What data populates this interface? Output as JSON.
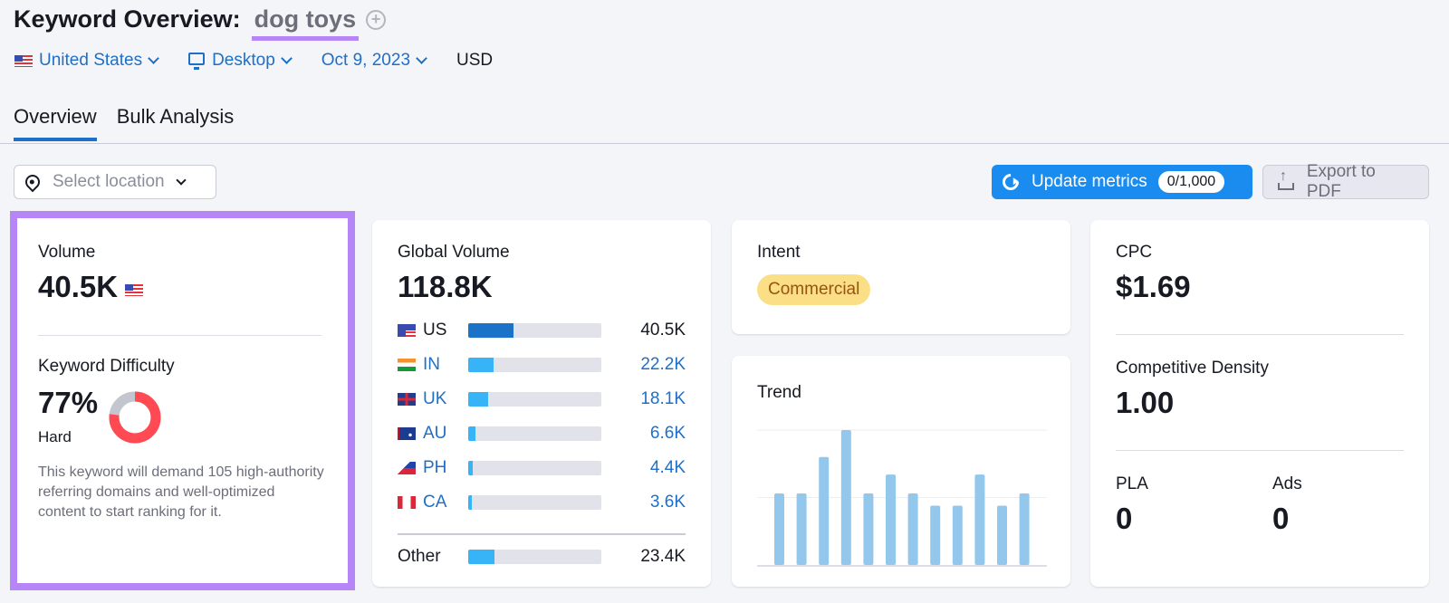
{
  "header": {
    "title": "Keyword Overview:",
    "keyword": "dog toys",
    "add_icon": "plus-circle-icon"
  },
  "filters": {
    "country": "United States",
    "device": "Desktop",
    "date": "Oct 9, 2023",
    "currency": "USD"
  },
  "tabs": [
    {
      "label": "Overview",
      "active": true
    },
    {
      "label": "Bulk Analysis",
      "active": false
    }
  ],
  "toolbar": {
    "location_placeholder": "Select location",
    "update_label": "Update metrics",
    "update_counter": "0/1,000",
    "export_label": "Export to PDF"
  },
  "colors": {
    "accent": "#1a8cef",
    "highlight": "#b685f7",
    "difficulty_hard": "#ff4953",
    "bar_primary": "#1a73c9",
    "bar_secondary": "#36b4f7",
    "trend_bar": "#93c7ec",
    "intent_badge_bg": "#fbdf87"
  },
  "volume_card": {
    "volume_label": "Volume",
    "volume_value": "40.5K",
    "kd_label": "Keyword Difficulty",
    "kd_value": "77%",
    "kd_percent": 77,
    "kd_level": "Hard",
    "kd_description": "This keyword will demand 105 high-authority referring domains and well-optimized content to start ranking for it."
  },
  "global_volume": {
    "label": "Global Volume",
    "value": "118.8K",
    "rows": [
      {
        "code": "US",
        "value": "40.5K",
        "share": 0.34,
        "link": false
      },
      {
        "code": "IN",
        "value": "22.2K",
        "share": 0.19,
        "link": true
      },
      {
        "code": "UK",
        "value": "18.1K",
        "share": 0.15,
        "link": true
      },
      {
        "code": "AU",
        "value": "6.6K",
        "share": 0.055,
        "link": true
      },
      {
        "code": "PH",
        "value": "4.4K",
        "share": 0.037,
        "link": true
      },
      {
        "code": "CA",
        "value": "3.6K",
        "share": 0.03,
        "link": true
      }
    ],
    "other": {
      "label": "Other",
      "value": "23.4K",
      "share": 0.197
    }
  },
  "intent": {
    "label": "Intent",
    "badge": "Commercial"
  },
  "trend": {
    "label": "Trend",
    "values": [
      0.53,
      0.53,
      0.8,
      1.0,
      0.53,
      0.67,
      0.53,
      0.44,
      0.44,
      0.67,
      0.44,
      0.53
    ]
  },
  "cpc_card": {
    "cpc_label": "CPC",
    "cpc_value": "$1.69",
    "cd_label": "Competitive Density",
    "cd_value": "1.00",
    "pla_label": "PLA",
    "pla_value": "0",
    "ads_label": "Ads",
    "ads_value": "0"
  }
}
